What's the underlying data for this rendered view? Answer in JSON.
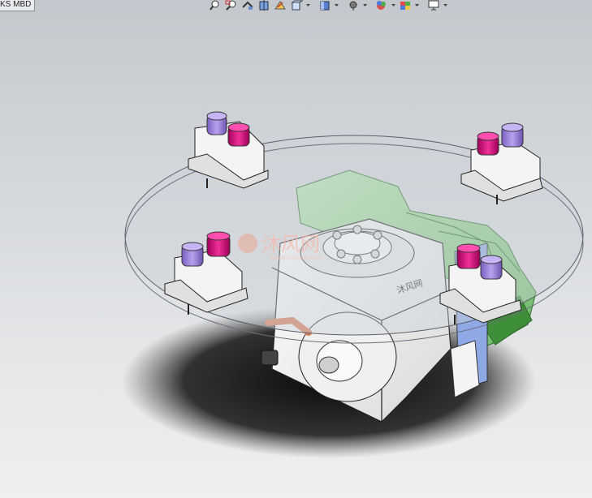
{
  "tab": {
    "label": "KS MBD"
  },
  "toolbar": {
    "buttons": [
      {
        "name": "zoom-to-fit-icon"
      },
      {
        "name": "zoom-to-area-icon"
      },
      {
        "name": "previous-view-icon"
      },
      {
        "name": "section-view-icon"
      },
      {
        "name": "dynamic-annotation-icon"
      },
      {
        "name": "view-orientation-icon"
      },
      {
        "name": "display-style-icon"
      },
      {
        "name": "hide-show-items-icon"
      },
      {
        "name": "edit-appearance-icon"
      },
      {
        "name": "apply-scene-icon"
      },
      {
        "name": "view-settings-icon"
      }
    ]
  },
  "watermark": {
    "title": "沐风网",
    "url": "www.mfcad.com"
  },
  "model": {
    "nameplate_text": "沐风网",
    "colors": {
      "plate": "#c9ced6",
      "body": "#f2f2f2",
      "motor": "#8fd08f",
      "cap_purple": "#9a7fd6",
      "cap_magenta": "#d6137a",
      "shadow": "#1a1a1a",
      "pipe": "#d97c5a",
      "side_panel": "#8fa8e6"
    }
  }
}
